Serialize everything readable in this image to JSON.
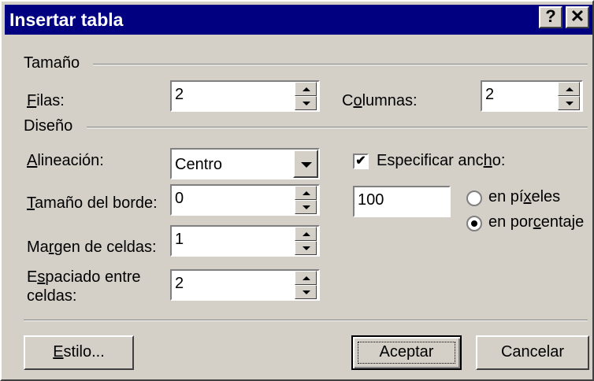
{
  "dialog": {
    "title": "Insertar tabla",
    "help_button": "?",
    "close_button": "✕"
  },
  "size_group": {
    "label": "Tamaño",
    "rows_label": {
      "u": "F",
      "rest": "ilas:"
    },
    "rows_value": "2",
    "columns_label": {
      "pre": "C",
      "u": "o",
      "rest": "lumnas:"
    },
    "columns_value": "2"
  },
  "layout_group": {
    "label": "Diseño",
    "alignment_label": {
      "u": "A",
      "rest": "lineación:"
    },
    "alignment_value": "Centro",
    "border_label": {
      "u": "T",
      "rest": "amaño del borde:"
    },
    "border_value": "0",
    "padding_label": {
      "pre": "Ma",
      "u": "r",
      "rest": "gen de celdas:"
    },
    "padding_value": "1",
    "spacing_label_line1": {
      "pre": "E",
      "u": "s",
      "rest": "paciado entre"
    },
    "spacing_label_line2": "celdas:",
    "spacing_value": "2",
    "specify_width_label": {
      "pre": "Especificar anc",
      "u": "h",
      "rest": "o:"
    },
    "specify_width_checked": true,
    "width_value": "100",
    "pixels_label": {
      "pre": "en pí",
      "u": "x",
      "rest": "eles"
    },
    "percent_label": {
      "pre": "en por",
      "u": "c",
      "rest": "entaje"
    },
    "width_unit_selected": "en porcentaje"
  },
  "buttons": {
    "style": {
      "u": "E",
      "rest": "stilo..."
    },
    "ok": "Aceptar",
    "cancel": "Cancelar"
  },
  "colors": {
    "titlebar": "#000080",
    "face": "#d4d0c8"
  },
  "icons": {
    "checkmark": "✔"
  }
}
